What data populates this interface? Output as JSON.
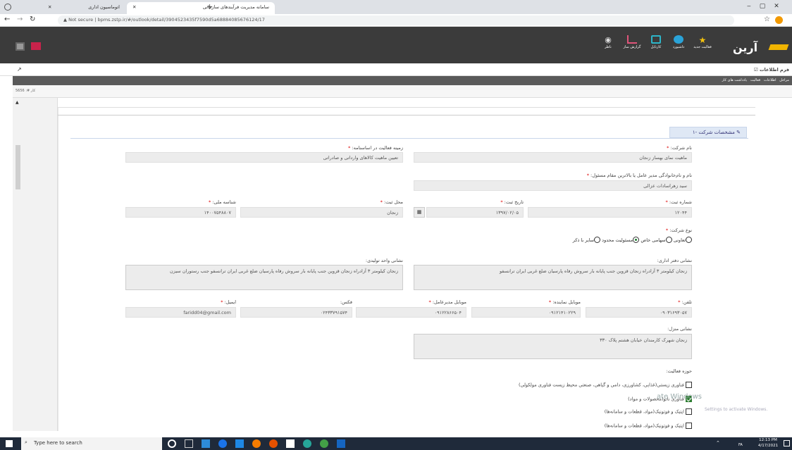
{
  "browser": {
    "tabs": [
      {
        "label": "سامانه مدیریت فرآیندهای سازمانی"
      },
      {
        "label": "اتوماسیون اداری"
      }
    ],
    "new_tab": "+",
    "url": "Not secure | bpms.zstp.ir/#/outlook/detail/3904523435f7590d5a6888408567612​4/17"
  },
  "app": {
    "logo": "آرین",
    "nav": [
      {
        "label": "فعالیت جدید"
      },
      {
        "label": "داشبورد"
      },
      {
        "label": "کارتابل"
      },
      {
        "label": "گزارش ساز"
      },
      {
        "label": "ناظر"
      }
    ],
    "sheet_title": "فرم اطلاعات",
    "steps": [
      "مراحل",
      "اطلاعات",
      "فعالیت",
      "یادداشت های کار"
    ],
    "case_no": "کار #: 5656"
  },
  "form": {
    "section_title": "۱- مشخصات شرکت",
    "company_name_label": "نام شرکت:",
    "company_name": "ماهیت نمای بهساز زنجان",
    "activity_field_label": "زمینه فعالیت در اساسنامه:",
    "activity_field": "تعیین ماهیت کالاهای وارداتی و صادراتی",
    "ceo_label": "نام و نام‌خانوادگی مدیر عامل یا بالاترین مقام مسئول:",
    "ceo": "سید زهراسادات عزالی",
    "reg_no_label": "شماره ثبت:",
    "reg_no": "۱۲۰۴۴",
    "reg_date_label": "تاریخ ثبت:",
    "reg_date": "۱۳۹۷/۰۲/۰۵",
    "reg_place_label": "محل ثبت:",
    "reg_place": "زنجان",
    "national_id_label": "شناسه ملی:",
    "national_id": "۱۴۰۰۷۵۴۸۸۰۷",
    "company_type_label": "نوع شرکت:",
    "company_types": [
      {
        "label": "تعاونی"
      },
      {
        "label": "سهامی خاص"
      },
      {
        "label": "مسئولیت محدود"
      },
      {
        "label": "سایر با ذکر"
      }
    ],
    "office_addr_label": "نشانی دفتر اداری:",
    "office_addr": "زنجان کیلومتر ۳ آزادراه زنجان قزوین جنب پایانه بار سروش رفاه پارسیان ضلع غربی ایران ترانسفو",
    "factory_addr_label": "نشانی واحد تولیدی:",
    "factory_addr": "زنجان کیلومتر ۳ آزادراه زنجان قزوین جنب پایانه بار سروش رفاه پارسیان ضلع غربی ایران ترانسفو جنب رستوران سیزن",
    "phone_label": "تلفن:",
    "phone": "۰۹۰۳۱۶۹۳۰۵۷",
    "rep_mobile_label": "موبایل نماینده:",
    "rep_mobile": "۰۹۱۲۱۴۱۰۲۲۹",
    "ceo_mobile_label": "موبایل مدیرعامل:",
    "ceo_mobile": "۰۹۱۲۲۸۶۶۵۰۴",
    "fax_label": "فکس:",
    "fax": "۰۲۴۳۳۷۹۱۵۷۴",
    "email_label": "ایمیل:",
    "email": "faridd04@gmail.com",
    "home_addr_label": "نشانی منزل:",
    "home_addr": "زنجان شهرک کارمندان خیابان هشتم پلاک ۳۳۰",
    "domain_label": "حوزه فعالیت:",
    "domains": [
      {
        "label": "فناوری زیستی(غذایی، کشاورزی، دامی و گیاهی، صنعتی محیط زیست فناوری مولکولی)"
      },
      {
        "label": "فناوری نانو(محصولات و مواد)"
      },
      {
        "label": "اپتیک و فوتونیک(مواد، قطعات و سامانه‌ها)"
      },
      {
        "label": "اپتیک و فوتونیک(مواد، قطعات و سامانه‌ها)"
      }
    ]
  },
  "overlay": {
    "activate_title": "ate Windows",
    "activate_sub": "Settings to activate Windows."
  },
  "taskbar": {
    "search_placeholder": "Type here to search",
    "time": "12:13 PM",
    "date": "4/17/2021",
    "lang": "FA"
  }
}
